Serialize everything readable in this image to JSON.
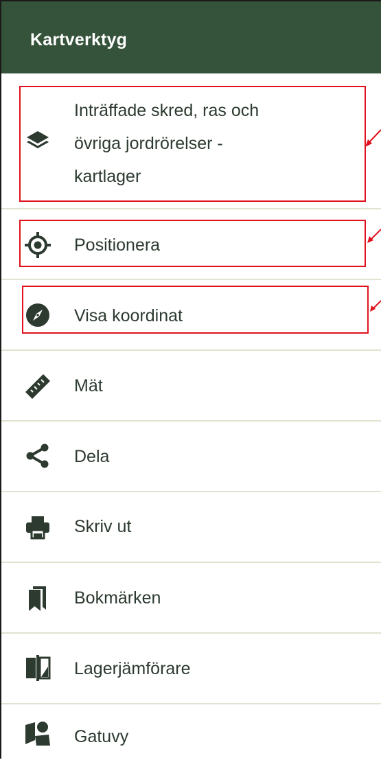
{
  "panel": {
    "title": "Kartverktyg"
  },
  "items": [
    {
      "label": "Inträffade skred, ras och\növriga jordrörelser -\nkartlager",
      "icon": "layers-icon"
    },
    {
      "label": "Positionera",
      "icon": "crosshair-icon"
    },
    {
      "label": "Visa koordinat",
      "icon": "compass-icon"
    },
    {
      "label": "Mät",
      "icon": "ruler-icon"
    },
    {
      "label": "Dela",
      "icon": "share-icon"
    },
    {
      "label": "Skriv ut",
      "icon": "printer-icon"
    },
    {
      "label": "Bokmärken",
      "icon": "bookmarks-icon"
    },
    {
      "label": "Lagerjämförare",
      "icon": "layer-compare-icon"
    },
    {
      "label": "Gatuvy",
      "icon": "street-view-icon"
    }
  ],
  "colors": {
    "header_bg": "#35523a",
    "icon": "#2c3a2f",
    "divider": "#dfe3cf",
    "annotation": "#e0101c"
  }
}
